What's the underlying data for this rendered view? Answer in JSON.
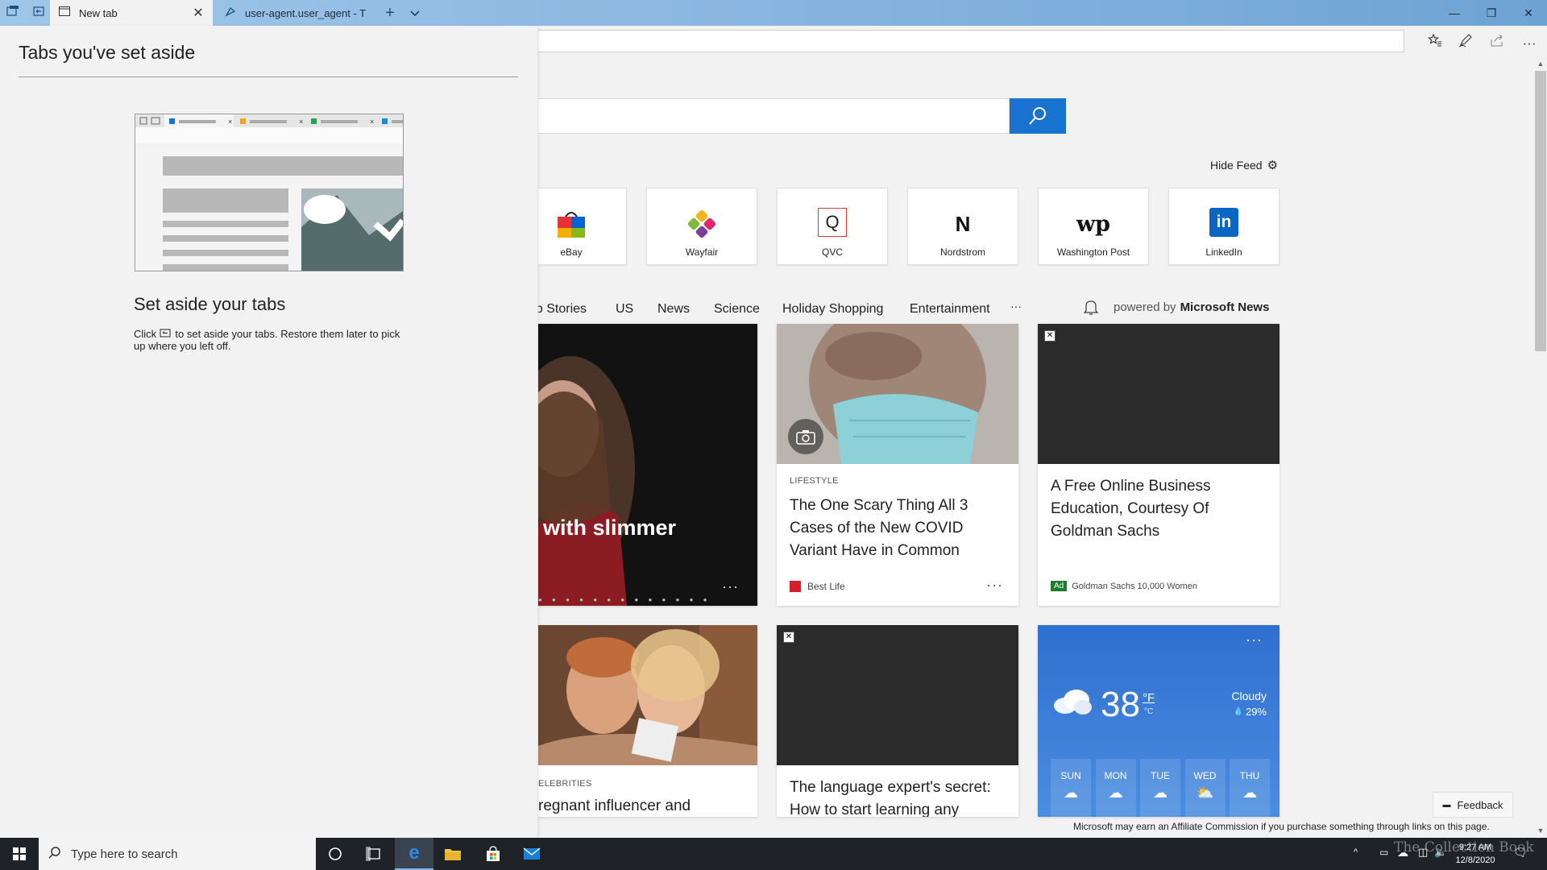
{
  "browser": {
    "tabs": [
      {
        "title": "New tab",
        "active": true
      },
      {
        "title": "user-agent.user_agent - The"
      }
    ],
    "address_value": ""
  },
  "search": {
    "placeholder": ""
  },
  "hide_feed_label": "Hide Feed",
  "top_sites": [
    {
      "label": "eBay"
    },
    {
      "label": "Wayfair"
    },
    {
      "label": "QVC",
      "glyph": "Q"
    },
    {
      "label": "Nordstrom",
      "glyph": "N"
    },
    {
      "label": "Washington Post",
      "glyph": "wp"
    },
    {
      "label": "LinkedIn",
      "glyph": "in"
    }
  ],
  "news_nav": {
    "items": [
      "op Stories",
      "US",
      "News",
      "Science",
      "Holiday Shopping",
      "Entertainment",
      "···"
    ],
    "powered_by_prefix": "powered by",
    "powered_by_name": "Microsoft News"
  },
  "cards": {
    "hero": {
      "title": "with slimmer",
      "dots": "● ● ● ● ● ● ● ● ● ● ● ● ●",
      "more": "···"
    },
    "covid": {
      "category": "LIFESTYLE",
      "title": "The One Scary Thing All 3 Cases of the New COVID Variant Have in Common",
      "source": "Best Life",
      "more": "···"
    },
    "ad": {
      "title": "A Free Online Business Education, Courtesy Of Goldman Sachs",
      "badge": "Ad",
      "source": "Goldman Sachs 10,000 Women"
    },
    "celebrity": {
      "category": "ELEBRITIES",
      "title": "regnant influencer and"
    },
    "language": {
      "title": "The language expert's secret: How to start learning any"
    },
    "weather": {
      "temperature": "38",
      "unit_f": "°F",
      "unit_c": "°C",
      "condition": "Cloudy",
      "precip": "29%",
      "more": "···",
      "days": [
        "SUN",
        "MON",
        "TUE",
        "WED",
        "THU"
      ]
    }
  },
  "affiliate_note": "Microsoft may earn an Affiliate Commission if you purchase something through links on this page.",
  "feedback_label": "Feedback",
  "aside_panel": {
    "title": "Tabs you've set aside",
    "heading": "Set aside your tabs",
    "desc_before": "Click",
    "desc_after": "to set aside your tabs. Restore them later to pick up where you left off."
  },
  "taskbar": {
    "search_placeholder": "Type here to search",
    "time": "9:27 AM",
    "date": "12/8/2020"
  },
  "watermark": "The Collection Book",
  "colors": {
    "accent": "#1a73d1",
    "taskbar": "#1f2327",
    "panel": "#f2f2f2",
    "weather": "#3a7bd5"
  }
}
